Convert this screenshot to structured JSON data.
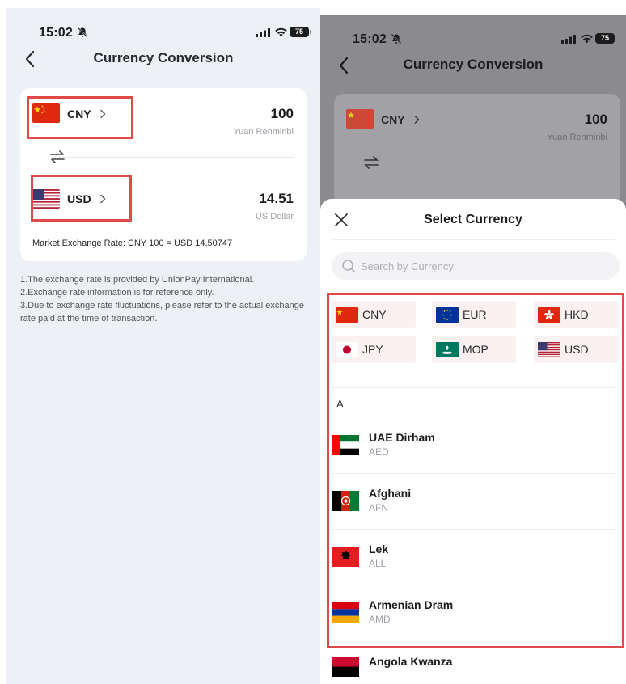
{
  "left_screen": {
    "status": {
      "time": "15:02",
      "battery": "75"
    },
    "nav": {
      "title": "Currency Conversion"
    },
    "from": {
      "code": "CNY",
      "amount": "100",
      "name": "Yuan Renminbi"
    },
    "to": {
      "code": "USD",
      "amount": "14.51",
      "name": "US Dollar"
    },
    "rate_text": "Market Exchange Rate:  CNY 100 = USD 14.50747",
    "notes": [
      "1.The exchange rate is provided by UnionPay International.",
      "2.Exchange rate information is for reference only.",
      "3.Due to exchange rate fluctuations, please refer to the actual exchange rate paid at the time of transaction."
    ]
  },
  "right_screen": {
    "status": {
      "time": "15:02",
      "battery": "75"
    },
    "nav": {
      "title": "Currency Conversion"
    },
    "bg_from": {
      "code": "CNY",
      "amount": "100",
      "name": "Yuan Renminbi"
    },
    "sheet": {
      "title": "Select Currency",
      "search_placeholder": "Search by Currency",
      "quick": [
        "CNY",
        "EUR",
        "HKD",
        "JPY",
        "MOP",
        "USD"
      ],
      "section": "A",
      "items": [
        {
          "name": "UAE Dirham",
          "code": "AED"
        },
        {
          "name": "Afghani",
          "code": "AFN"
        },
        {
          "name": "Lek",
          "code": "ALL"
        },
        {
          "name": "Armenian Dram",
          "code": "AMD"
        },
        {
          "name": "Angola Kwanza",
          "code": ""
        }
      ]
    }
  },
  "colors": {
    "highlight": "#e24a4a",
    "page_bg": "#eef0f8",
    "quick_bg": "#fbf1f1"
  }
}
